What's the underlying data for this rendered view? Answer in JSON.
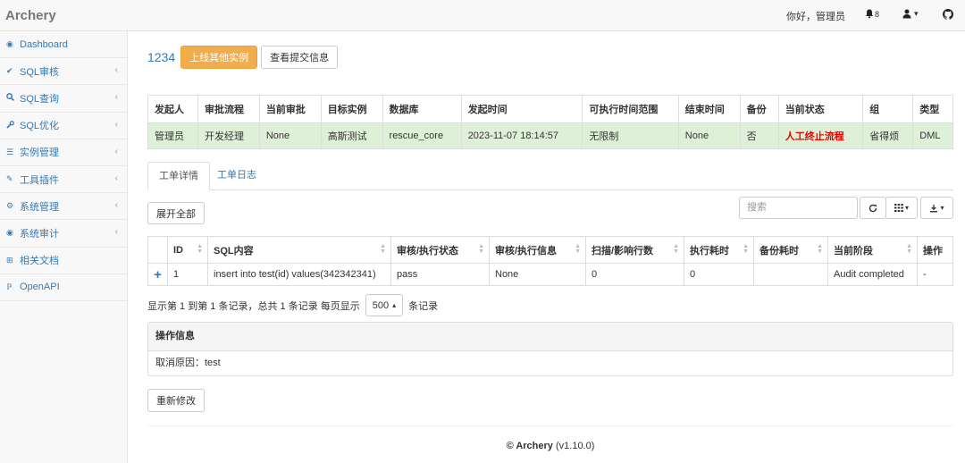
{
  "app": {
    "brand": "Archery"
  },
  "topbar": {
    "greeting": "你好，管理员",
    "bell_count": "8",
    "user_caret": "▾"
  },
  "sidebar": {
    "items": [
      {
        "icon": "dashboard-icon",
        "glyph": "◉",
        "label": "Dashboard",
        "expandable": false
      },
      {
        "icon": "check-icon",
        "glyph": "✔",
        "label": "SQL审核",
        "expandable": true
      },
      {
        "icon": "search-icon",
        "glyph": "🔍︎",
        "label": "SQL查询",
        "expandable": true
      },
      {
        "icon": "wrench-icon",
        "glyph": "🔧︎",
        "label": "SQL优化",
        "expandable": true
      },
      {
        "icon": "database-icon",
        "glyph": "☰",
        "label": "实例管理",
        "expandable": true
      },
      {
        "icon": "plug-icon",
        "glyph": "✎",
        "label": "工具插件",
        "expandable": true
      },
      {
        "icon": "cogs-icon",
        "glyph": "⚙",
        "label": "系统管理",
        "expandable": true
      },
      {
        "icon": "eye-icon",
        "glyph": "◉",
        "label": "系统审计",
        "expandable": true
      },
      {
        "icon": "sitemap-icon",
        "glyph": "⊞",
        "label": "相关文档",
        "expandable": false
      },
      {
        "icon": "api-icon",
        "glyph": "ℙ",
        "label": "OpenAPI",
        "expandable": false
      }
    ]
  },
  "header": {
    "workflow_name": "1234",
    "online_btn": "上线其他实例",
    "view_btn": "查看提交信息"
  },
  "info_table": {
    "columns": [
      "发起人",
      "审批流程",
      "当前审批",
      "目标实例",
      "数据库",
      "发起时间",
      "可执行时间范围",
      "结束时间",
      "备份",
      "当前状态",
      "组",
      "类型"
    ],
    "row": [
      "管理员",
      "开发经理",
      "None",
      "高斯测试",
      "rescue_core",
      "2023-11-07 18:14:57",
      "无限制",
      "None",
      "否",
      "人工终止流程",
      "省得烦",
      "DML"
    ]
  },
  "tabs": {
    "detail": "工单详情",
    "log": "工单日志"
  },
  "toolbar": {
    "expand_all": "展开全部",
    "search_placeholder": "搜索"
  },
  "sql_table": {
    "columns": [
      "ID",
      "SQL内容",
      "审核/执行状态",
      "审核/执行信息",
      "扫描/影响行数",
      "执行耗时",
      "备份耗时",
      "当前阶段",
      "操作"
    ],
    "rows": [
      [
        "1",
        "insert into test(id) values(342342341)",
        "pass",
        "None",
        "0",
        "0",
        "",
        "Audit completed",
        "-"
      ]
    ]
  },
  "pagination": {
    "summary": "显示第 1 到第 1 条记录，总共 1 条记录  每页显示",
    "page_size": "500",
    "suffix": "条记录"
  },
  "panel": {
    "title": "操作信息",
    "body": "取消原因：test"
  },
  "actions": {
    "remodify": "重新修改"
  },
  "footer": {
    "text": "© Archery",
    "version": "(v1.10.0)"
  }
}
